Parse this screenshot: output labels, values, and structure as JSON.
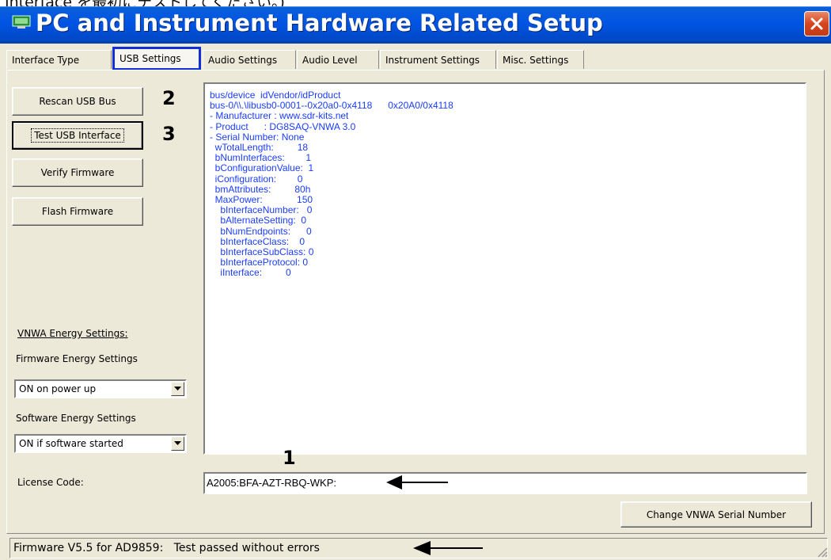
{
  "window": {
    "title": "PC and Instrument Hardware Related Setup",
    "top_caption": "Interface を最初にテストしてください。)"
  },
  "tabs": [
    {
      "label": "Interface Type"
    },
    {
      "label": "USB Settings",
      "selected": true
    },
    {
      "label": "Audio Settings"
    },
    {
      "label": "Audio Level"
    },
    {
      "label": "Instrument Settings"
    },
    {
      "label": "Misc. Settings"
    }
  ],
  "buttons": {
    "rescan": "Rescan USB Bus",
    "test": "Test USB Interface",
    "verify": "Verify Firmware",
    "flash": "Flash Firmware",
    "change_serial": "Change VNWA Serial Number"
  },
  "annotations": {
    "num1": "1",
    "num2": "2",
    "num3": "3"
  },
  "energy": {
    "section_label": "VNWA Energy Settings:",
    "firmware_label": "Firmware Energy Settings",
    "firmware_value": "ON on power up",
    "software_label": "Software Energy Settings",
    "software_value": "ON if software started"
  },
  "usb_info": [
    "bus/device  idVendor/idProduct",
    "bus-0/\\\\.\\libusb0-0001--0x20a0-0x4118      0x20A0/0x4118",
    "- Manufacturer : www.sdr-kits.net",
    "- Product      : DG8SAQ-VNWA 3.0",
    "- Serial Number: None",
    "  wTotalLength:         18",
    "  bNumInterfaces:        1",
    "  bConfigurationValue:  1",
    "  iConfiguration:        0",
    "  bmAttributes:         80h",
    "  MaxPower:             150",
    "    bInterfaceNumber:   0",
    "    bAlternateSetting:  0",
    "    bNumEndpoints:      0",
    "    bInterfaceClass:    0",
    "    bInterfaceSubClass: 0",
    "    bInterfaceProtocol: 0",
    "    iInterface:         0"
  ],
  "license": {
    "label": "License Code:",
    "value": "A2005:BFA-AZT-RBQ-WKP:"
  },
  "status": {
    "text": "Firmware V5.5 for AD9859:   Test passed without errors"
  },
  "colors": {
    "titlebar": "#0054e3",
    "text_blue": "#1a3cff",
    "tab_highlight": "#1130d8",
    "close": "#d6451f"
  }
}
